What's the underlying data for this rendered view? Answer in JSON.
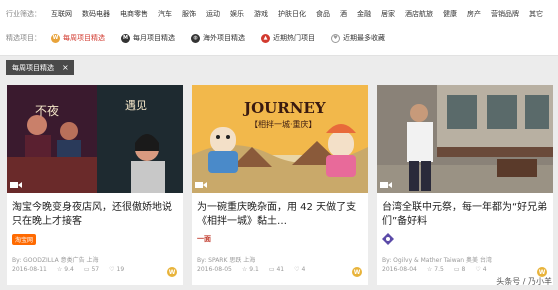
{
  "filters": {
    "industry_label": "行业筛选：",
    "industries": [
      "互联网",
      "数码电器",
      "电商零售",
      "汽车",
      "服饰",
      "运动",
      "娱乐",
      "游戏",
      "护肤日化",
      "食品",
      "酒",
      "金融",
      "居家",
      "酒店航旅",
      "健康",
      "房产",
      "营销品牌",
      "其它"
    ],
    "featured_label": "精选项目：",
    "options": [
      {
        "label": "每周项目精选",
        "icon": "w-badge-icon",
        "color": "#e8a33a",
        "active": true
      },
      {
        "label": "每月项目精选",
        "icon": "m-badge-icon",
        "color": "#333333",
        "active": false
      },
      {
        "label": "海外项目精选",
        "icon": "globe-icon",
        "color": "#333333",
        "active": false
      },
      {
        "label": "近期热门项目",
        "icon": "fire-icon",
        "color": "#d23a2f",
        "active": false
      },
      {
        "label": "近期最多收藏",
        "icon": "heart-icon",
        "color": "#999999",
        "active": false
      }
    ]
  },
  "active_tag": {
    "label": "每周项目精选"
  },
  "cards": [
    {
      "title": "淘宝今晚变身夜店风，还很傲娇地说只在晚上才接客",
      "logo": "淘宝网",
      "author": "By: GOODZILLA 意类广告 上海",
      "date": "2016-08-11",
      "rating": "9.4",
      "comments": "57",
      "likes": "19",
      "badge": "W"
    },
    {
      "title": "为一碗重庆晚杂面，用 42 天做了支《相拌一城》黏土…",
      "logo": "一面",
      "author": "By: SPARK 思跃 上海",
      "date": "2016-08-05",
      "rating": "9.1",
      "comments": "41",
      "likes": "4",
      "badge": "W"
    },
    {
      "title": "台湾全联中元祭，每一年都为“好兄弟们”备好料",
      "logo": "",
      "author": "By: Ogilvy & Mather Taiwan 奥美 台湾",
      "date": "2016-08-04",
      "rating": "7.5",
      "comments": "8",
      "likes": "4",
      "badge": "W"
    }
  ],
  "watermark": "头条号 / 乃小羊"
}
